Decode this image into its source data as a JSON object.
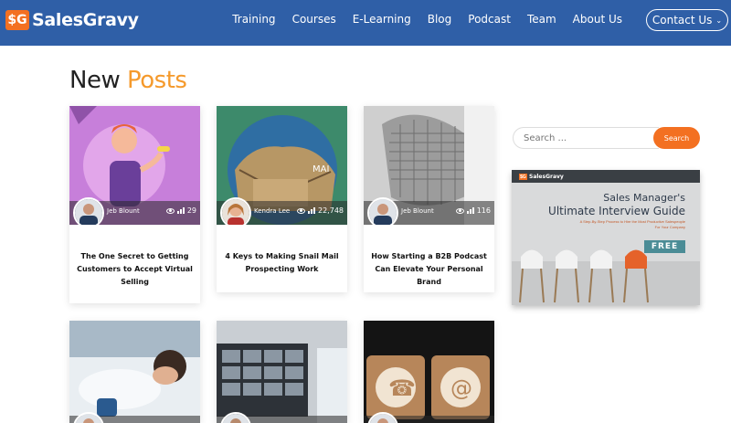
{
  "brand": {
    "logo_mark": "$G",
    "name": "SalesGravy"
  },
  "nav": {
    "links": [
      "Training",
      "Courses",
      "E-Learning",
      "Blog",
      "Podcast",
      "Team",
      "About Us"
    ],
    "contact_label": "Contact Us"
  },
  "heading": {
    "word1": "New",
    "word2": "Posts"
  },
  "posts": [
    {
      "author": "Jeb Blount",
      "views": "29",
      "title": "The One Secret to Getting Customers to Accept Virtual Selling"
    },
    {
      "author": "Kendra Lee",
      "views": "22,748",
      "title": "4 Keys to Making Snail Mail Prospecting Work"
    },
    {
      "author": "Jeb Blount",
      "views": "116",
      "title": "How Starting a B2B Podcast Can Elevate Your Personal Brand"
    }
  ],
  "sidebar": {
    "search_placeholder": "Search ...",
    "search_button": "Search",
    "ad": {
      "logo": "SalesGravy",
      "title_line1": "Sales Manager's",
      "title_line2": "Ultimate Interview Guide",
      "subtitle": "A Step-By-Step Process to Hire the Most Productive Salespeople For Your Company",
      "free_label": "FREE"
    }
  },
  "colors": {
    "nav": "#2f5fa7",
    "accent": "#f37021",
    "heading_accent": "#f59a2c"
  }
}
